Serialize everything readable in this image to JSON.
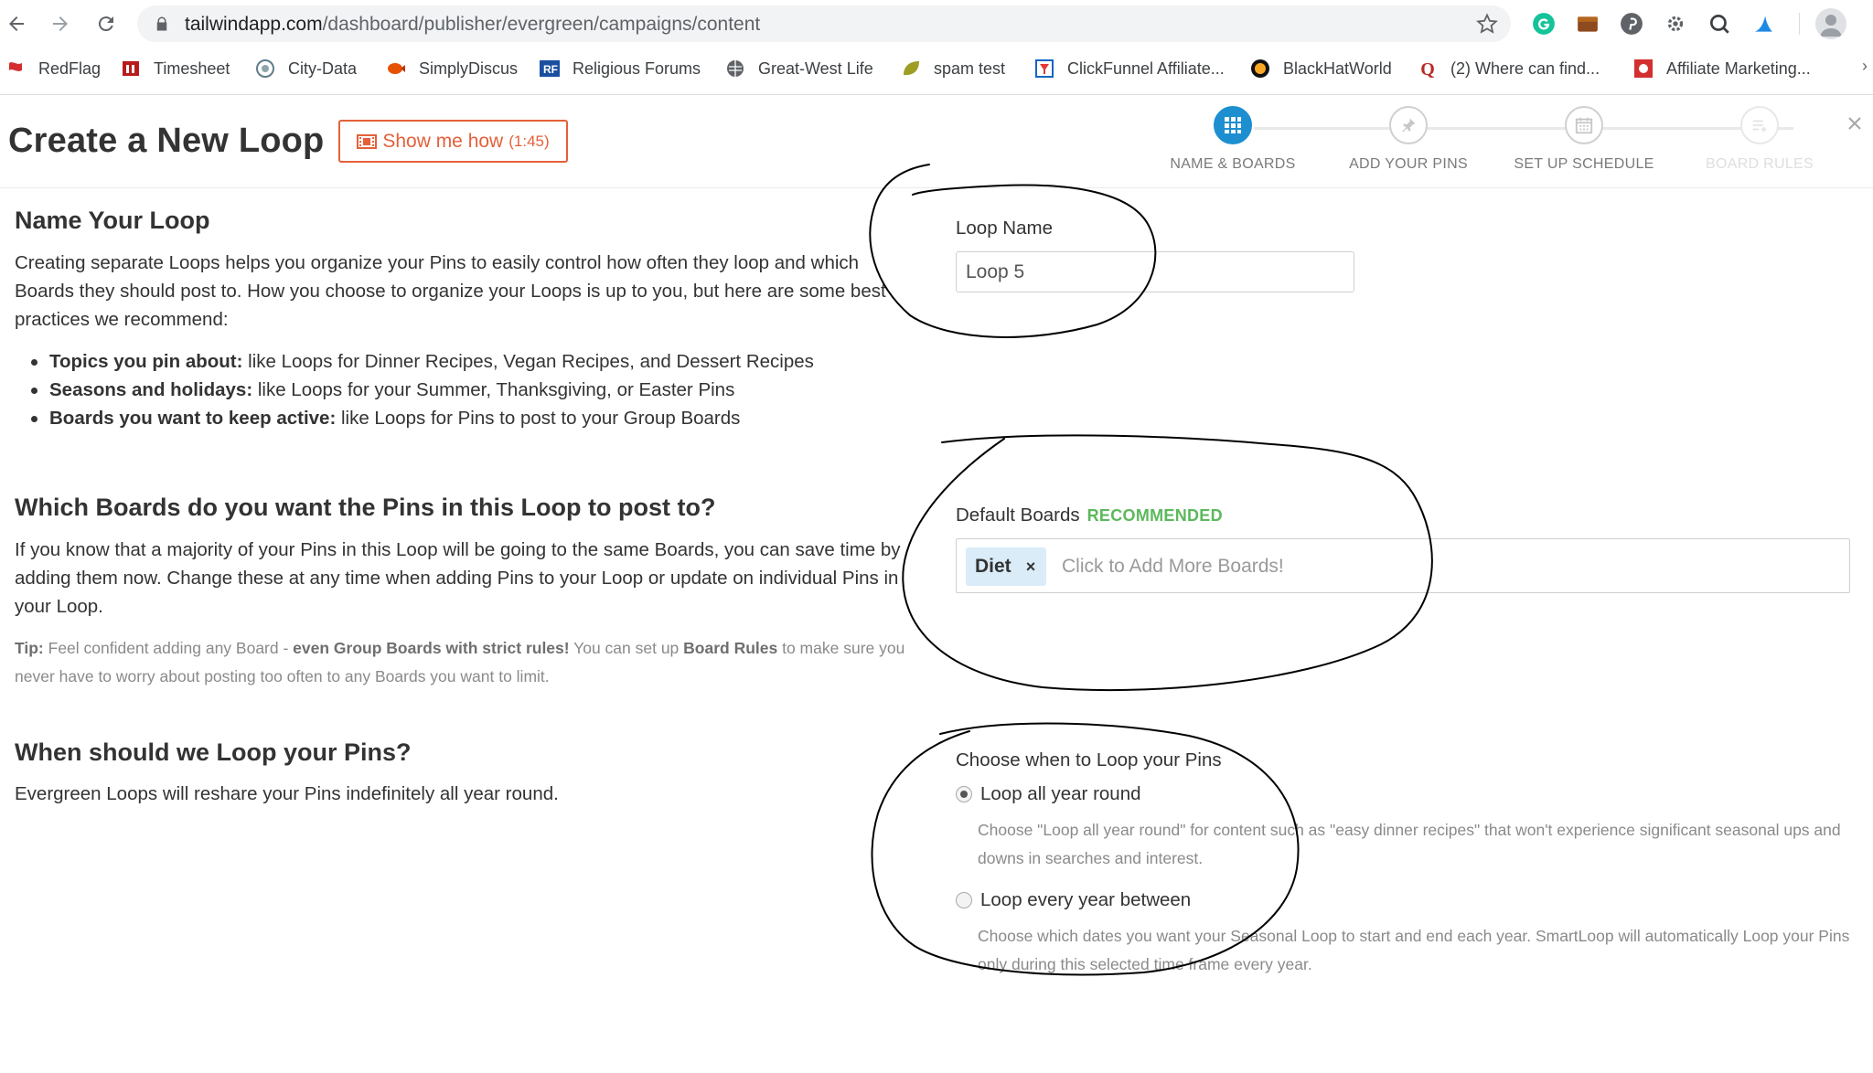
{
  "browser": {
    "url_host": "tailwindapp.com",
    "url_path": "/dashboard/publisher/evergreen/campaigns/content",
    "extensions": [
      "grammarly-icon",
      "brown-box-icon",
      "pinterest-icon",
      "gear-puzzle-icon",
      "search-q-icon",
      "blue-wave-icon"
    ]
  },
  "bookmarks": [
    {
      "label": "RedFlag",
      "icon": "redflag-icon",
      "color": "#d32f2f"
    },
    {
      "label": "Timesheet",
      "icon": "timesheet-icon",
      "color": "#b71c1c"
    },
    {
      "label": "City-Data",
      "icon": "city-data-icon",
      "color": "#607d8b"
    },
    {
      "label": "SimplyDiscus",
      "icon": "fish-icon",
      "color": "#e65100"
    },
    {
      "label": "Religious Forums",
      "icon": "rf-icon",
      "color": "#1a4fa0"
    },
    {
      "label": "Great-West Life",
      "icon": "globe-icon",
      "color": "#5f6368"
    },
    {
      "label": "spam test",
      "icon": "leaf-icon",
      "color": "#9e9d24"
    },
    {
      "label": "ClickFunnel Affiliate...",
      "icon": "clickfunnel-icon",
      "color": "#1565c0"
    },
    {
      "label": "BlackHatWorld",
      "icon": "bhw-icon",
      "color": "#111111"
    },
    {
      "label": "(2) Where can find...",
      "icon": "quora-icon",
      "color": "#b92b27"
    },
    {
      "label": "Affiliate Marketing...",
      "icon": "affiliate-icon",
      "color": "#d32f2f"
    }
  ],
  "header": {
    "title": "Create a New Loop",
    "howto_label": "Show me how",
    "howto_duration": "(1:45)",
    "steps": [
      {
        "label": "NAME & BOARDS",
        "state": "active"
      },
      {
        "label": "ADD YOUR PINS",
        "state": "upcoming"
      },
      {
        "label": "SET UP SCHEDULE",
        "state": "upcoming"
      },
      {
        "label": "BOARD RULES",
        "state": "disabled"
      }
    ]
  },
  "name_section": {
    "heading": "Name Your Loop",
    "intro": "Creating separate Loops helps you organize your Pins to easily control how often they loop and which Boards they should post to. How you choose to organize your Loops is up to you, but here are some best practices we recommend:",
    "bullets": [
      {
        "bold": "Topics you pin about:",
        "text": " like Loops for Dinner Recipes, Vegan Recipes, and Dessert Recipes"
      },
      {
        "bold": "Seasons and holidays:",
        "text": " like Loops for your Summer, Thanksgiving, or Easter Pins"
      },
      {
        "bold": "Boards you want to keep active:",
        "text": " like Loops for Pins to post to your Group Boards"
      }
    ],
    "field_label": "Loop Name",
    "field_value": "Loop 5"
  },
  "boards_section": {
    "heading": "Which Boards do you want the Pins in this Loop to post to?",
    "intro": "If you know that a majority of your Pins in this Loop will be going to the same Boards, you can save time by adding them now. Change these at any time when adding Pins to your Loop or update on individual Pins in your Loop.",
    "tip_prefix": "Tip:",
    "tip_a": " Feel confident adding any Board - ",
    "tip_bold": "even Group Boards with strict rules!",
    "tip_b": " You can set up ",
    "tip_bold2": "Board Rules",
    "tip_c": " to make sure you never have to worry about posting too often to any Boards you want to limit.",
    "field_label": "Default Boards",
    "recommended": "RECOMMENDED",
    "chips": [
      "Diet"
    ],
    "remove_symbol": "×",
    "placeholder": "Click to Add More Boards!"
  },
  "schedule_section": {
    "heading": "When should we Loop your Pins?",
    "intro": "Evergreen Loops will reshare your Pins indefinitely all year round.",
    "field_label": "Choose when to Loop your Pins",
    "options": [
      {
        "label": "Loop all year round",
        "selected": true,
        "help": "Choose \"Loop all year round\" for content such as \"easy dinner recipes\" that won't experience significant seasonal ups and downs in searches and interest."
      },
      {
        "label": "Loop every year between",
        "selected": false,
        "help": "Choose which dates you want your Seasonal Loop to start and end each year. SmartLoop will automatically Loop your Pins only during this selected time frame every year."
      }
    ]
  },
  "colors": {
    "accent_blue": "#1d8fd1",
    "howto_orange": "#e5603a",
    "recommended_green": "#5cb85c",
    "chip_bg": "#d9ecf8"
  }
}
